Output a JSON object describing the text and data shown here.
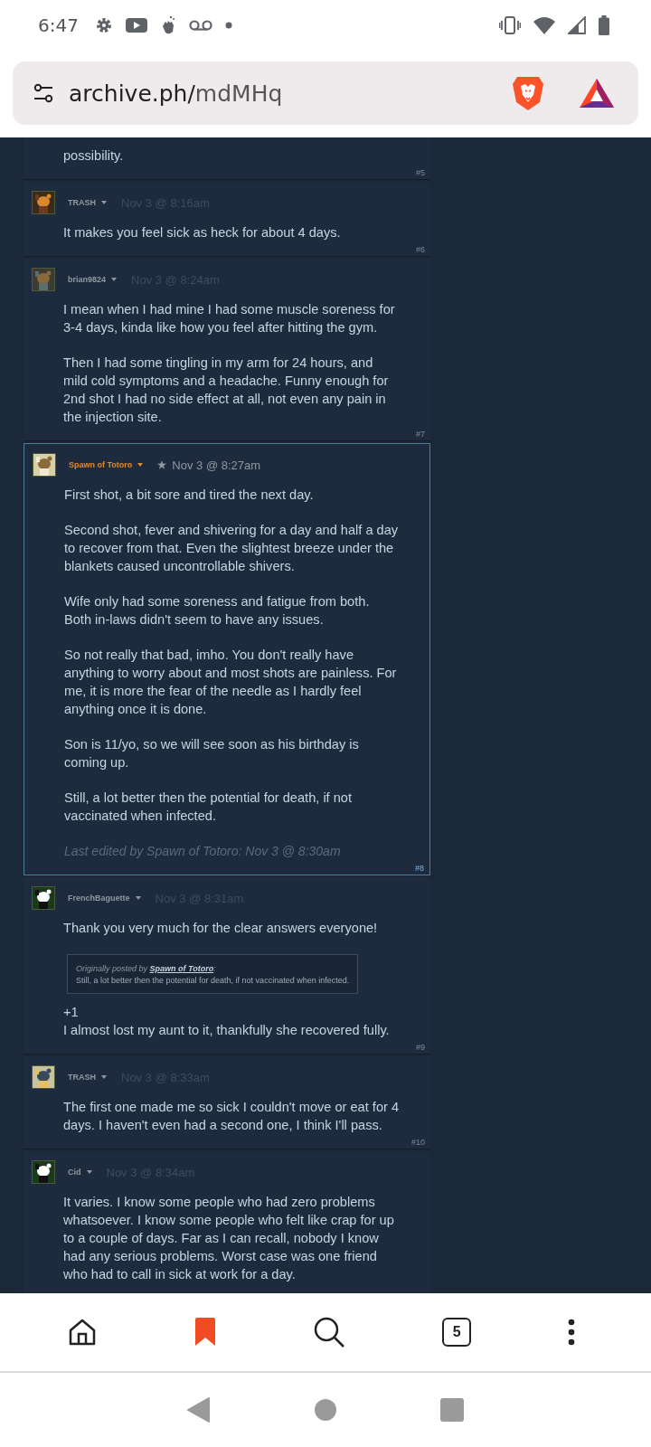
{
  "status_bar": {
    "time": "6:47"
  },
  "address_bar": {
    "host": "archive.ph/",
    "path": "mdMHq"
  },
  "comments": [
    {
      "paragraphs": [
        "possibility."
      ],
      "number": "#5"
    },
    {
      "author": "TRASH",
      "color": "#8f98a0",
      "starred": false,
      "highlighted": false,
      "date": "Nov 3 @ 8:16am",
      "paragraphs": [
        "It makes you feel sick as heck for about 4 days."
      ],
      "number": "#6"
    },
    {
      "author": "brian9824",
      "color": "#8f98a0",
      "starred": false,
      "highlighted": false,
      "date": "Nov 3 @ 8:24am",
      "paragraphs": [
        "I mean when I had mine I had some muscle soreness for 3-4 days, kinda like how you feel after hitting the gym.",
        "Then I had some tingling in my arm for 24 hours, and mild cold symptoms and a headache. Funny enough for 2nd shot I had no side effect at all, not even any pain in the injection site."
      ],
      "number": "#7"
    },
    {
      "author": "Spawn of Totoro",
      "color": "#e08a2c",
      "starred": true,
      "highlighted": true,
      "date": "Nov 3 @ 8:27am",
      "paragraphs": [
        "First shot, a bit sore and tired the next day.",
        "Second shot, fever and shivering for a day and half a day to recover from that. Even the slightest breeze under the blankets caused uncontrollable shivers.",
        "Wife only had some soreness and fatigue from both. Both in-laws didn't seem to have any issues.",
        "So not really that bad, imho. You don't really have anything to worry about and most shots are painless. For me, it is more the fear of the needle as I hardly feel anything once it is done.",
        "Son is 11/yo, so we will see soon as his birthday is coming up.",
        "Still, a lot better then the potential for death, if not vaccinated when infected."
      ],
      "edited": "Last edited by Spawn of Totoro: Nov 3 @ 8:30am",
      "number": "#8"
    },
    {
      "author": "FrenchBaguette",
      "color": "#8f98a0",
      "starred": false,
      "highlighted": false,
      "date": "Nov 3 @ 8:31am",
      "paragraphs": [
        "Thank you very much for the clear answers everyone!"
      ],
      "quote": {
        "prefix": "Originally posted by",
        "author": "Spawn of Totoro",
        "suffix": ":",
        "text": "Still, a lot better then the potential for death, if not vaccinated when infected."
      },
      "after_quote": [
        "+1",
        "I almost lost my aunt to it, thankfully she recovered fully."
      ],
      "number": "#9"
    },
    {
      "author": "TRASH",
      "color": "#8f98a0",
      "starred": false,
      "highlighted": false,
      "date": "Nov 3 @ 8:33am",
      "paragraphs": [
        "The first one made me so sick I couldn't move or eat for 4 days. I haven't even had a second one, I think I'll pass."
      ],
      "number": "#10"
    },
    {
      "author": "Cid",
      "color": "#8f98a0",
      "starred": false,
      "highlighted": false,
      "date": "Nov 3 @ 8:34am",
      "paragraphs": [
        "It varies. I know some people who had zero problems whatsoever. I know some people who felt like crap for up to a couple of days. Far as I can recall, nobody I know had any serious problems. Worst case was one friend who had to call in sick at work for a day."
      ]
    }
  ],
  "bottom_bar": {
    "tab_count": "5"
  }
}
